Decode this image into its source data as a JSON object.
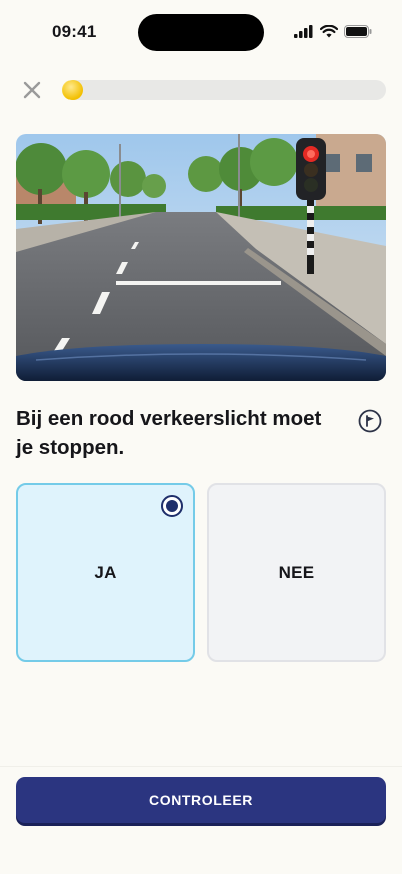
{
  "status_bar": {
    "time": "09:41",
    "icons": [
      "signal-icon",
      "wifi-icon",
      "battery-icon"
    ]
  },
  "progress": {
    "fraction": 0.03,
    "accent_color": "#f5c400"
  },
  "scene": {
    "description_icon": "road-with-traffic-light-image"
  },
  "question": {
    "text": "Bij een rood verkeerslicht moet je stoppen."
  },
  "answers": [
    {
      "label": "JA",
      "selected": true
    },
    {
      "label": "NEE",
      "selected": false
    }
  ],
  "actions": {
    "check_label": "CONTROLEER",
    "button_color": "#2b3580"
  }
}
